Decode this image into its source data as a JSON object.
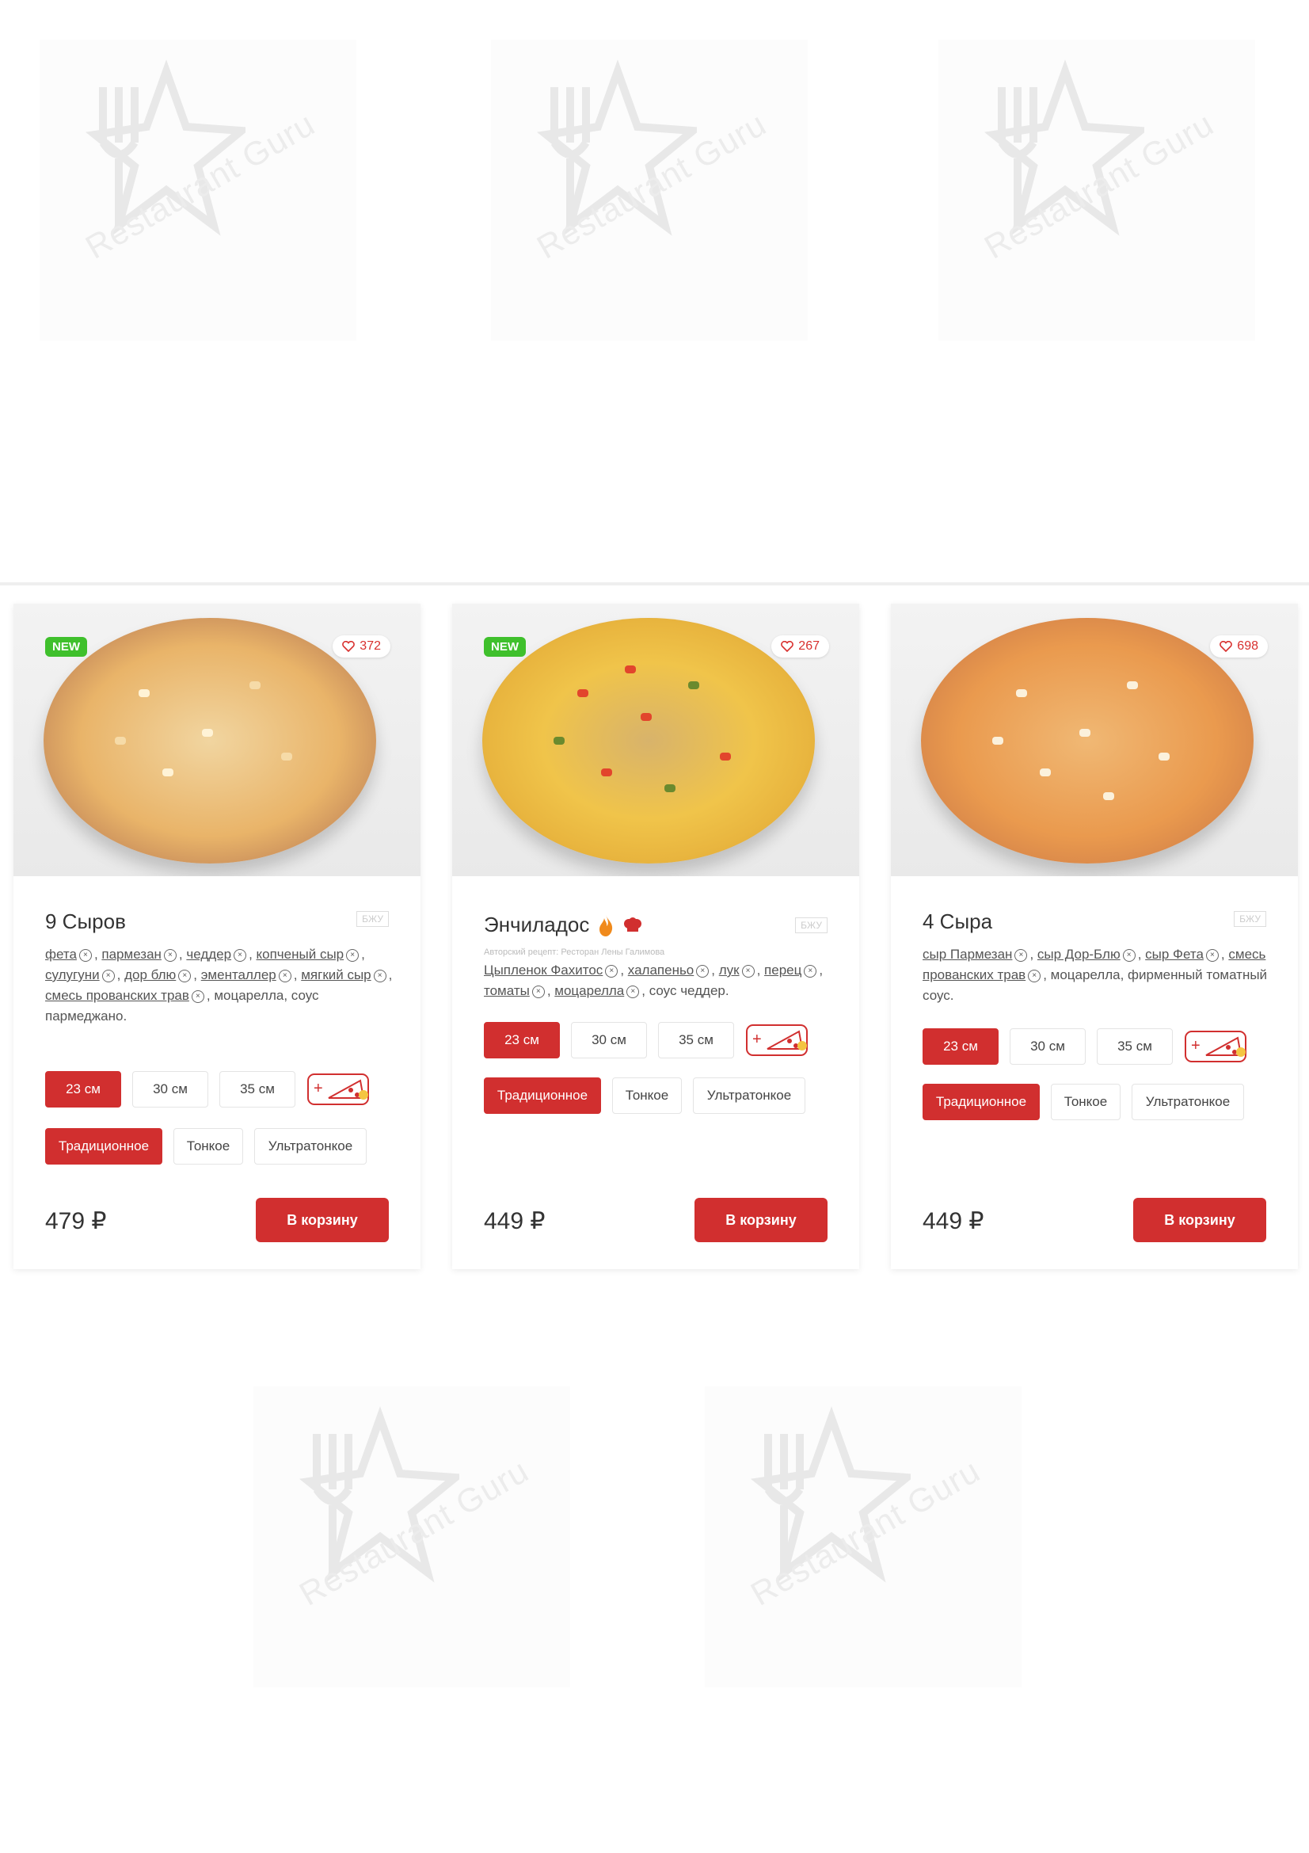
{
  "watermark": "Restaurant Guru",
  "cards": [
    {
      "badge": "NEW",
      "likes": "372",
      "title": "9 Сыров",
      "bju": "БЖУ",
      "author": "",
      "ingredients": [
        "фета",
        "пармезан",
        "чеддер",
        "копченый сыр",
        "сулугуни",
        "дор блю",
        "эменталлер",
        "мягкий сыр",
        "смесь прованских трав"
      ],
      "extra": ", моцарелла, соус пармеджано.",
      "sizes": [
        "23 см",
        "30 см",
        "35 см"
      ],
      "selected_size": "23 см",
      "crusts": [
        "Традиционное",
        "Тонкое",
        "Ультратонкое"
      ],
      "selected_crust": "Традиционное",
      "price": "479 ₽",
      "cart": "В корзину"
    },
    {
      "badge": "NEW",
      "likes": "267",
      "title": "Энчиладос",
      "bju": "БЖУ",
      "author": "Авторский рецепт: Ресторан Лены Галимова",
      "ingredients": [
        "Цыпленок Фахитос",
        "халапеньо",
        "лук",
        "перец",
        "томаты",
        "моцарелла"
      ],
      "extra": ", соус чеддер.",
      "sizes": [
        "23 см",
        "30 см",
        "35 см"
      ],
      "selected_size": "23 см",
      "crusts": [
        "Традиционное",
        "Тонкое",
        "Ультратонкое"
      ],
      "selected_crust": "Традиционное",
      "price": "449 ₽",
      "cart": "В корзину"
    },
    {
      "badge": "",
      "likes": "698",
      "title": "4 Сыра",
      "bju": "БЖУ",
      "author": "",
      "ingredients": [
        "сыр Пармезан",
        "сыр Дор-Блю",
        "сыр Фета",
        "смесь прованских трав"
      ],
      "extra": ", моцарелла, фирменный томатный соус.",
      "sizes": [
        "23 см",
        "30 см",
        "35 см"
      ],
      "selected_size": "23 см",
      "crusts": [
        "Традиционное",
        "Тонкое",
        "Ультратонкое"
      ],
      "selected_crust": "Традиционное",
      "price": "449 ₽",
      "cart": "В корзину"
    }
  ],
  "colors": {
    "accent": "#d12f2f",
    "new_badge": "#3fc02c"
  },
  "icons": {
    "like": "heart-icon",
    "addon": "add-topping-icon",
    "spicy": "flame-icon",
    "chef": "chef-hat-icon",
    "remove": "remove-ingredient-icon"
  }
}
